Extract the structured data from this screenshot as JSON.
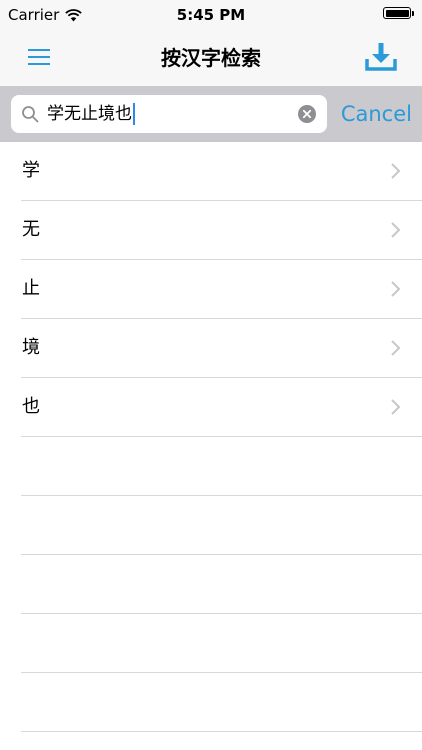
{
  "status_bar": {
    "carrier": "Carrier",
    "time": "5:45 PM",
    "battery_level": 1.0
  },
  "nav": {
    "title": "按汉字检索",
    "left_icon": "menu-icon",
    "right_icon": "download-icon",
    "accent_color": "#2a9ad8"
  },
  "search": {
    "value": "学无止境也",
    "cancel_label": "Cancel",
    "icon": "search-icon",
    "clear_icon": "clear-icon"
  },
  "results": [
    {
      "label": "学"
    },
    {
      "label": "无"
    },
    {
      "label": "止"
    },
    {
      "label": "境"
    },
    {
      "label": "也"
    }
  ],
  "empty_rows": 5
}
